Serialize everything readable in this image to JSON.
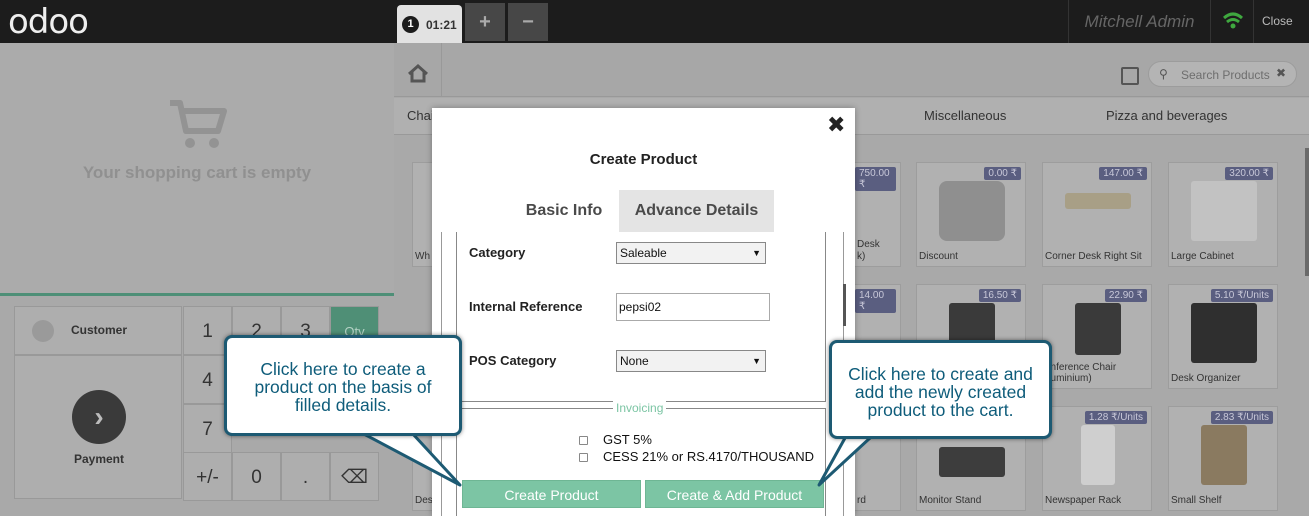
{
  "header": {
    "logo": "odoo",
    "order_number": "1",
    "order_time": "01:21",
    "add_label": "+",
    "remove_label": "−",
    "user": "Mitchell Admin",
    "close_label": "Close"
  },
  "cart": {
    "empty_text": "Your shopping cart is empty"
  },
  "numpad": {
    "customer_label": "Customer",
    "payment_label": "Payment",
    "payment_arrow": "›",
    "keys": [
      "1",
      "2",
      "3",
      "Qty",
      "4",
      "7",
      "+/-",
      "0",
      ".",
      "⌫"
    ]
  },
  "products_panel": {
    "search_placeholder": "Search Products",
    "search_clear": "✖",
    "categories": [
      "Chai",
      "Miscellaneous",
      "Pizza and beverages"
    ],
    "products": [
      {
        "name": "Wh",
        "price": ""
      },
      {
        "name": "k)",
        "price": "750.00 ₹",
        "extra": "Desk"
      },
      {
        "name": "Discount",
        "price": "0.00 ₹"
      },
      {
        "name": "Corner Desk Right Sit",
        "price": "147.00 ₹"
      },
      {
        "name": "Large Cabinet",
        "price": "320.00 ₹"
      },
      {
        "name": "",
        "price": "14.00 ₹"
      },
      {
        "name": "",
        "price": "16.50 ₹"
      },
      {
        "name": "onference Chair\n(luminium)",
        "price": "22.90 ₹"
      },
      {
        "name": "Desk Organizer",
        "price": "5.10 ₹/Units"
      },
      {
        "name": "Des",
        "price": ""
      },
      {
        "name": "rd",
        "price": ""
      },
      {
        "name": "Monitor Stand",
        "price": ""
      },
      {
        "name": "Newspaper Rack",
        "price": "1.28 ₹/Units"
      },
      {
        "name": "Small Shelf",
        "price": "2.83 ₹/Units"
      }
    ]
  },
  "modal": {
    "close": "✖",
    "title": "Create Product",
    "tabs": [
      "Basic Info",
      "Advance Details"
    ],
    "active_tab": "Advance Details",
    "fields": {
      "category_label": "Category",
      "category_value": "Saleable",
      "internal_ref_label": "Internal Reference",
      "internal_ref_value": "pepsi02",
      "pos_category_label": "POS Category",
      "pos_category_value": "None"
    },
    "invoicing": {
      "legend": "Invoicing",
      "taxes": [
        "GST 5%",
        "CESS 21% or RS.4170/THOUSAND"
      ]
    },
    "create_button": "Create Product",
    "create_add_button": "Create & Add Product"
  },
  "callouts": {
    "left": "Click here to create a product on the basis of filled details.",
    "right": "Click here to create and add the newly created product to the cart."
  },
  "colors": {
    "accent": "#7cc5a4",
    "callout_border": "#1d5a73",
    "callout_text": "#0e5c7a",
    "topbar": "#1c1c1c"
  }
}
